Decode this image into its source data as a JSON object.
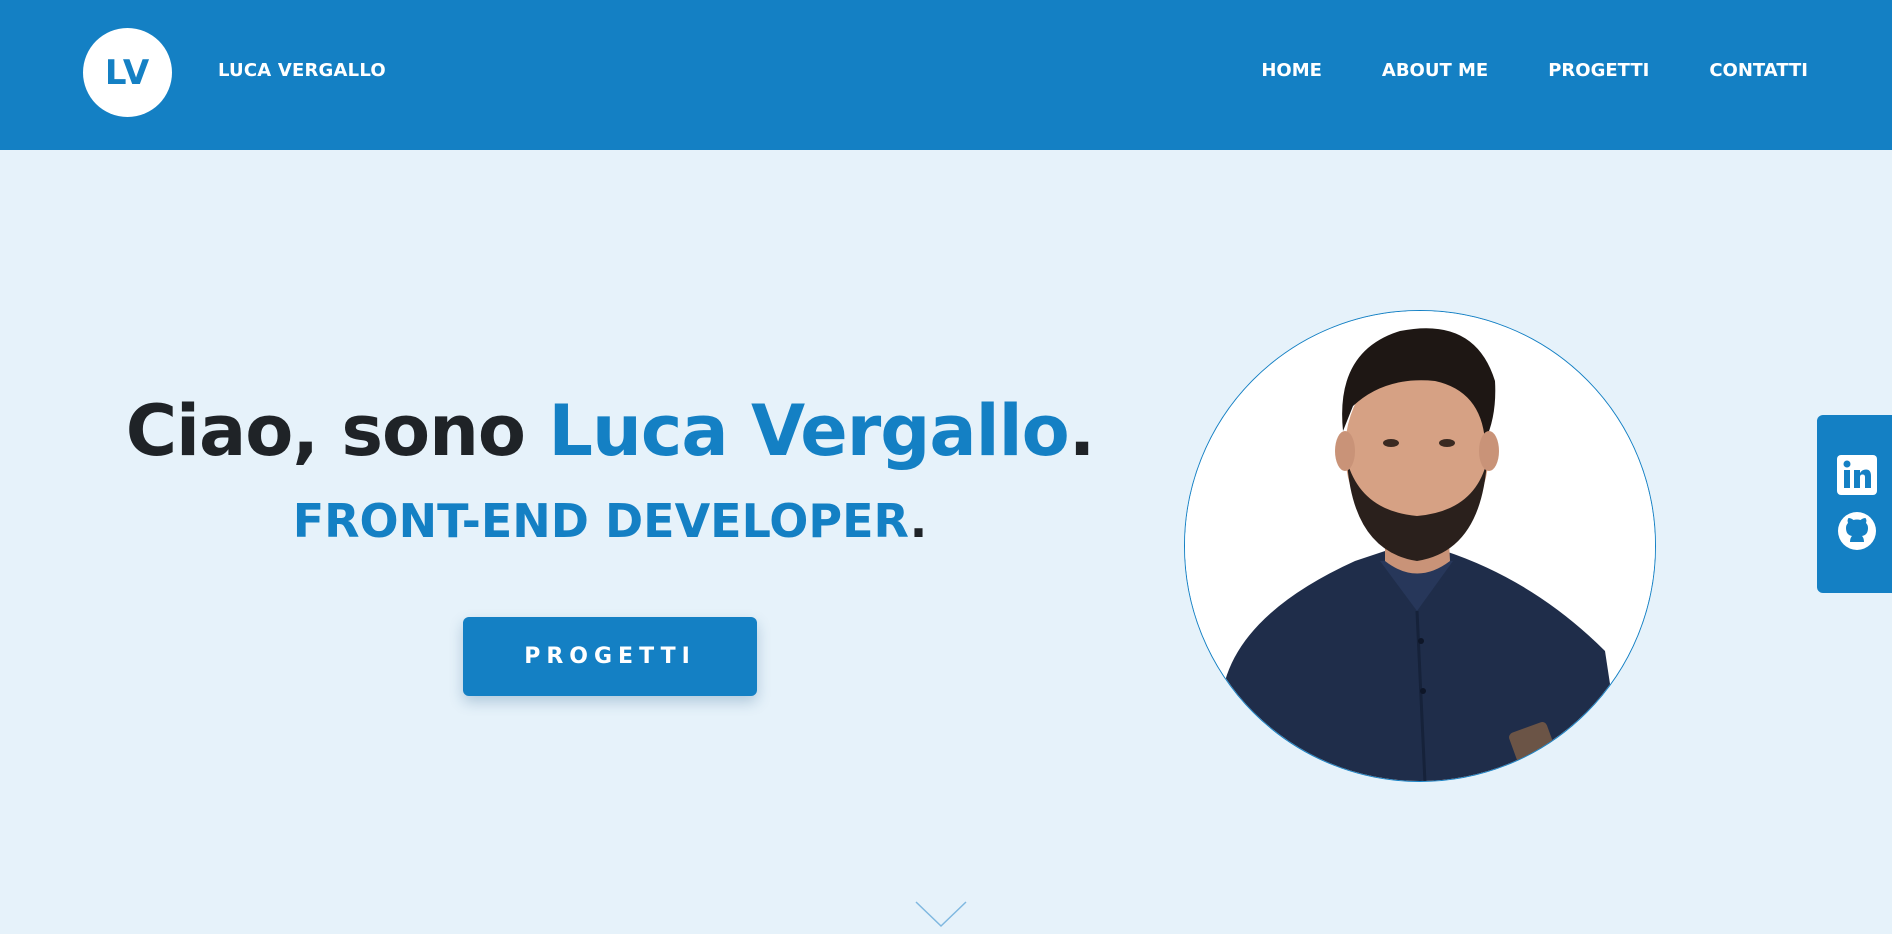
{
  "header": {
    "logo_initials": "LV",
    "brand_name": "LUCA VERGALLO",
    "nav": [
      {
        "label": "HOME"
      },
      {
        "label": "ABOUT ME"
      },
      {
        "label": "PROGETTI"
      },
      {
        "label": "CONTATTI"
      }
    ]
  },
  "hero": {
    "greeting": "Ciao, sono ",
    "name": "Luca Vergallo",
    "name_suffix": ".",
    "role": "FRONT-END DEVELOPER",
    "role_suffix": ".",
    "cta_label": "PROGETTI"
  },
  "social": {
    "items": [
      {
        "icon": "linkedin-icon"
      },
      {
        "icon": "github-icon"
      }
    ]
  },
  "scroll": {
    "icon": "chevron-down-icon"
  },
  "colors": {
    "primary": "#1480c4",
    "background": "#e6f2fa",
    "text_dark": "#1f2327",
    "white": "#ffffff"
  }
}
